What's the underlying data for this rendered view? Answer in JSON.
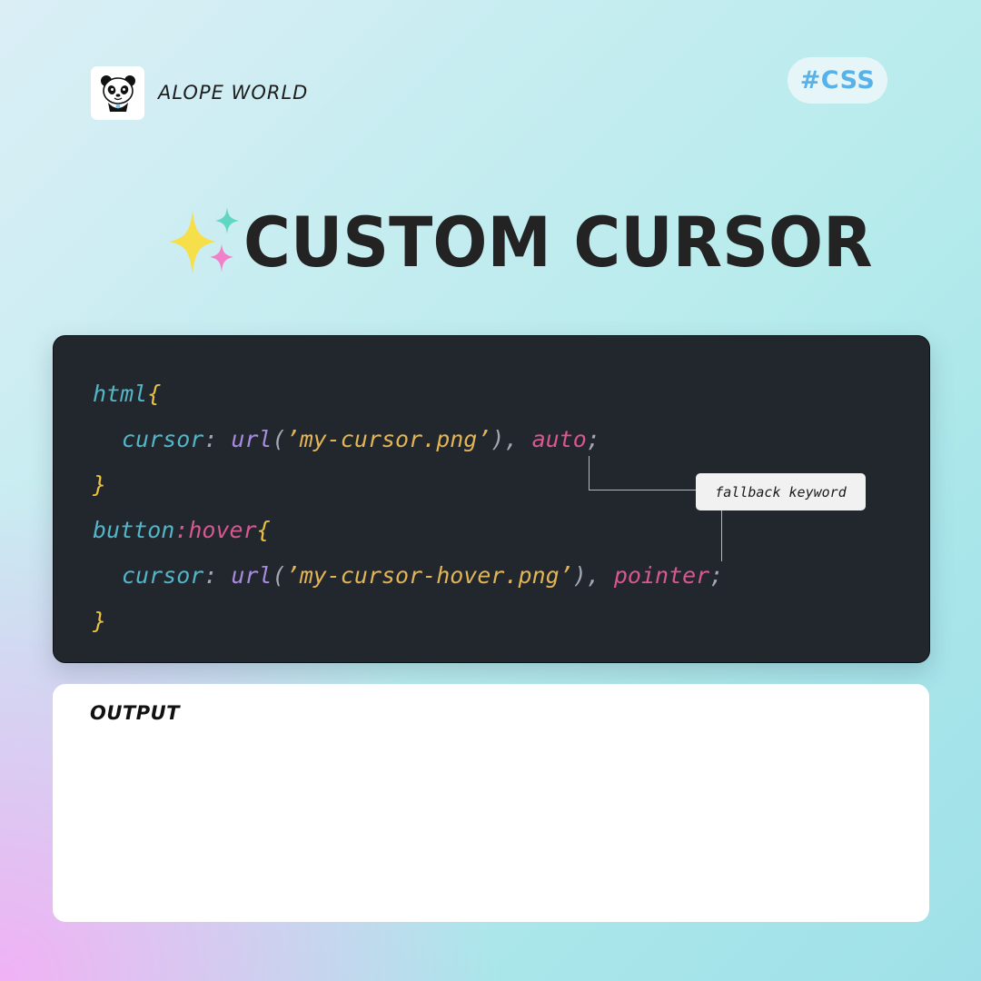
{
  "brand": {
    "name": "ALOPE WORLD",
    "logo_icon": "panda-icon"
  },
  "tag": {
    "label": "#CSS"
  },
  "title": {
    "text": "CUSTOM CURSOR",
    "icon": "sparkles-icon"
  },
  "code": {
    "lines": [
      {
        "tokens": [
          {
            "text": "html",
            "kind": "selector"
          },
          {
            "text": "{",
            "kind": "brace"
          }
        ]
      },
      {
        "tokens": [
          {
            "text": "cursor",
            "kind": "property"
          },
          {
            "text": ": ",
            "kind": "punct"
          },
          {
            "text": "url",
            "kind": "function"
          },
          {
            "text": "(",
            "kind": "punct"
          },
          {
            "text": "’my-cursor.png’",
            "kind": "string"
          },
          {
            "text": "), ",
            "kind": "punct"
          },
          {
            "text": "auto",
            "kind": "keyword"
          },
          {
            "text": ";",
            "kind": "punct"
          }
        ]
      },
      {
        "tokens": [
          {
            "text": "}",
            "kind": "brace"
          }
        ]
      },
      {
        "tokens": [
          {
            "text": "button",
            "kind": "selector"
          },
          {
            "text": ":hover",
            "kind": "keyword"
          },
          {
            "text": "{",
            "kind": "brace"
          }
        ]
      },
      {
        "tokens": [
          {
            "text": "cursor",
            "kind": "property"
          },
          {
            "text": ": ",
            "kind": "punct"
          },
          {
            "text": "url",
            "kind": "function"
          },
          {
            "text": "(",
            "kind": "punct"
          },
          {
            "text": "’my-cursor-hover.png’",
            "kind": "string"
          },
          {
            "text": "), ",
            "kind": "punct"
          },
          {
            "text": "pointer",
            "kind": "keyword"
          },
          {
            "text": ";",
            "kind": "punct"
          }
        ]
      },
      {
        "tokens": [
          {
            "text": "}",
            "kind": "brace"
          }
        ]
      }
    ],
    "callout": "fallback keyword"
  },
  "output": {
    "label": "OUTPUT"
  },
  "colors": {
    "selector": "#52b6c8",
    "brace": "#e8c341",
    "property": "#52b6c8",
    "punct": "#a3a8b3",
    "function": "#a98be0",
    "string": "#e2b655",
    "keyword": "#d8588f",
    "tag_text": "#58b2ea",
    "code_background": "#22262d"
  }
}
